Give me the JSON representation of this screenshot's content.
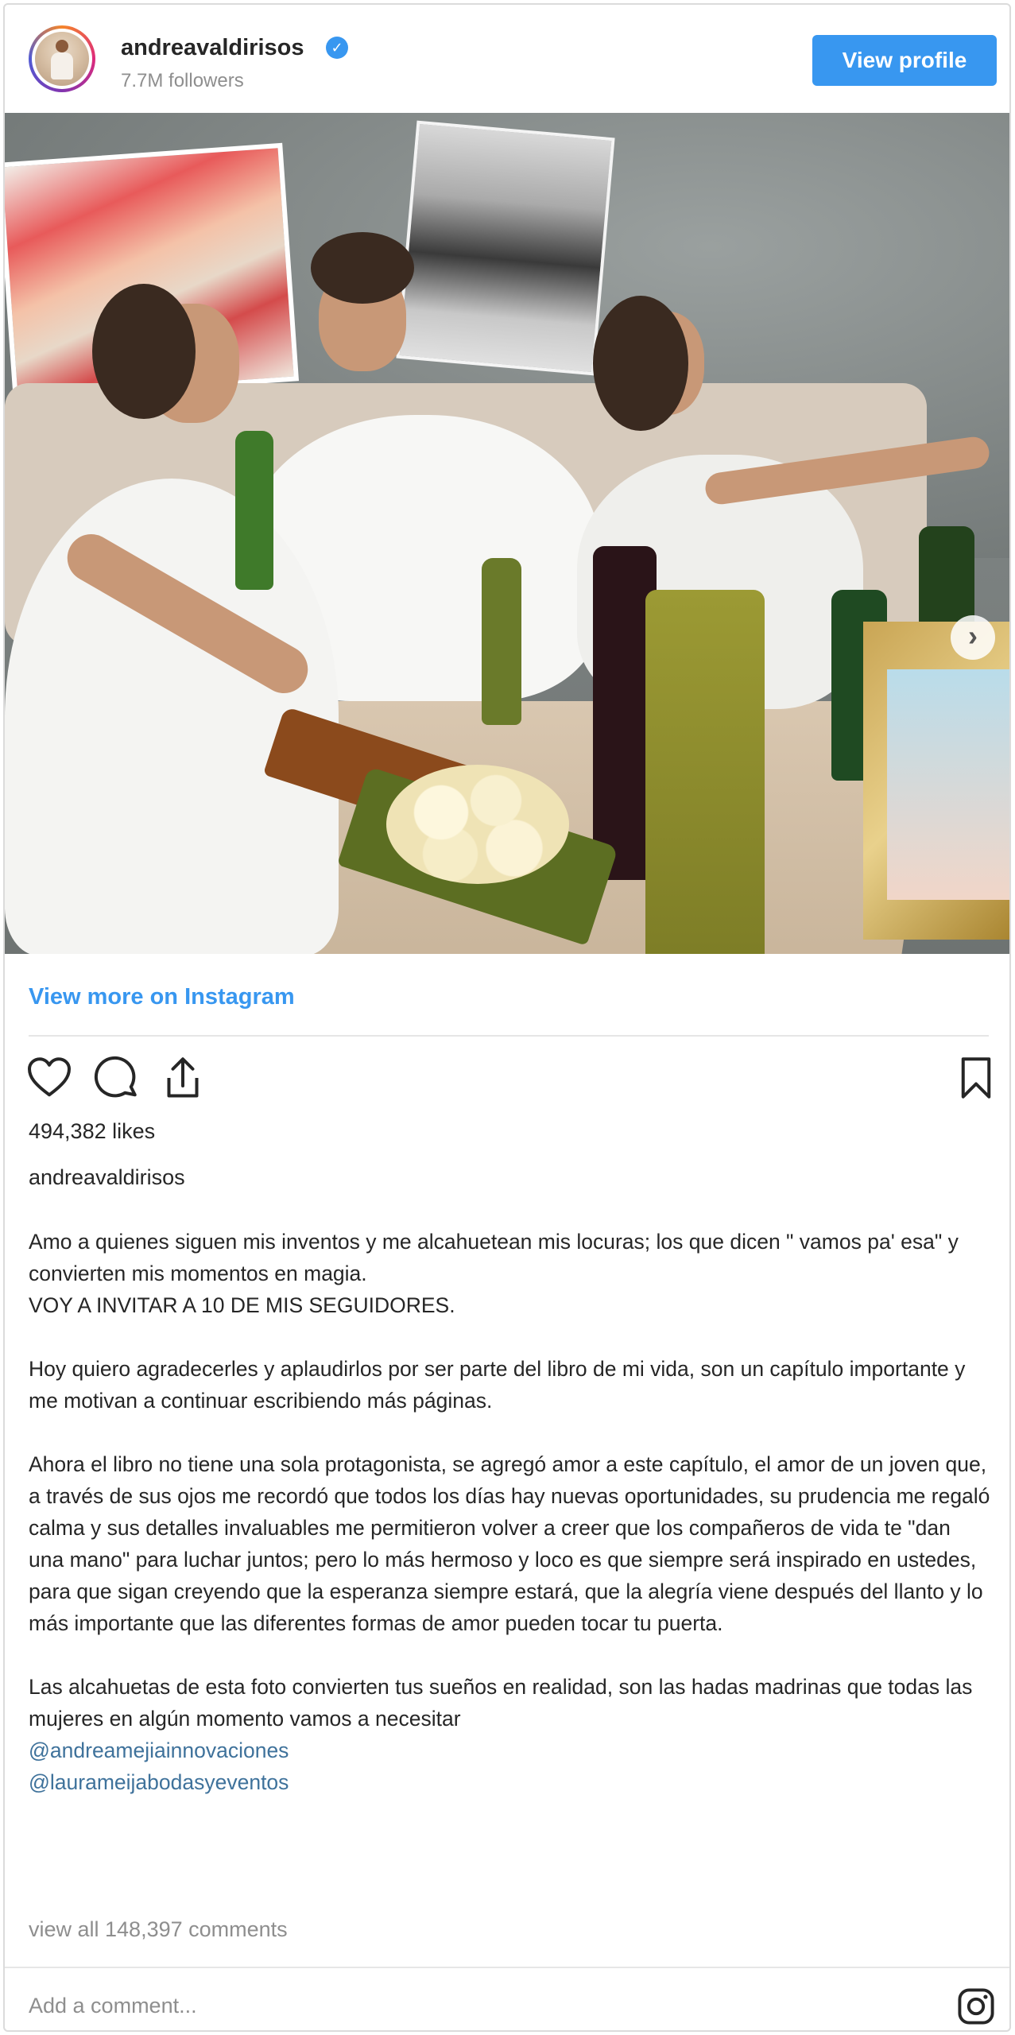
{
  "header": {
    "username": "andreavaldirisos",
    "verified_glyph": "✓",
    "followers": "7.7M followers",
    "view_profile_label": "View profile"
  },
  "photo": {
    "next_glyph": "›"
  },
  "links": {
    "view_more": "View more on Instagram"
  },
  "actions": {
    "icons": [
      "heart-icon",
      "comment-icon",
      "share-icon",
      "bookmark-icon"
    ]
  },
  "post": {
    "likes": "494,382 likes",
    "author": "andreavaldirisos",
    "caption": {
      "p1": "Amo a quienes siguen mis inventos y me alcahuetean mis locuras; los que dicen \" vamos pa' esa\" y convierten mis momentos en magia.\nVOY A INVITAR A 10 DE MIS SEGUIDORES.",
      "p2": "Hoy quiero agradecerles y aplaudirlos por ser parte del libro de mi vida, son un capítulo importante y me motivan a continuar escribiendo más páginas.",
      "p3": "Ahora el libro no tiene una sola protagonista, se agregó amor a este capítulo, el amor de un joven que, a través de sus ojos me recordó que todos los días hay nuevas oportunidades, su prudencia me regaló calma y sus detalles invaluables me permitieron volver a creer que los compañeros de vida te \"dan una mano\" para luchar juntos; pero lo más hermoso y loco es que siempre será inspirado en ustedes, para que sigan creyendo que la esperanza siempre estará, que la alegría viene después del llanto y lo más importante que las diferentes formas de amor pueden tocar tu puerta.",
      "p4": "Las alcahuetas de esta foto convierten tus sueños en realidad, son las hadas madrinas que todas las mujeres en algún momento vamos a necesitar",
      "mention1": "@andreamejiainnovaciones",
      "mention2": "@laurameijabodasyeventos"
    },
    "view_all_comments": "view all 148,397 comments",
    "add_comment_placeholder": "Add a comment..."
  },
  "colors": {
    "accent": "#3897f0",
    "link": "#3f729b",
    "muted": "#8e8e8e",
    "border": "#dbdbdb"
  }
}
